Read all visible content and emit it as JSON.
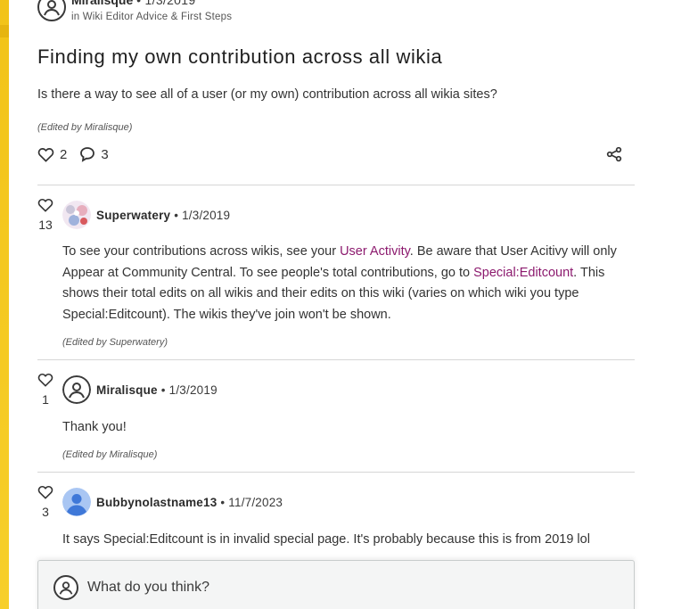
{
  "post": {
    "author": "Miralisque",
    "date": "1/3/2019",
    "forum": "in Wiki Editor Advice & First Steps",
    "title": "Finding my own contribution across all wikia",
    "body": "Is there a way to see all of a user (or my own) contribution across all wikia sites?",
    "edited": "(Edited by Miralisque)",
    "likes": "2",
    "replies": "3"
  },
  "replies": [
    {
      "likes": "13",
      "author": "Superwatery",
      "date": "1/3/2019",
      "body_1": "To see your contributions across wikis, see your ",
      "link_1": "User Activity",
      "body_2": ". Be aware that User Acitivy will only Appear at Community Central. To see people's total contributions, go to ",
      "link_2": "Special:Editcount",
      "body_3": ". This shows their total edits on all wikis and their edits on this wiki (varies on which wiki you type Special:Editcount). The wikis they've join won't be shown.",
      "edited": "(Edited by Superwatery)"
    },
    {
      "likes": "1",
      "author": "Miralisque",
      "date": "1/3/2019",
      "body": "Thank you!",
      "edited": "(Edited by Miralisque)"
    },
    {
      "likes": "3",
      "author": "Bubbynolastname13",
      "date": "11/7/2023",
      "body": "It says Special:Editcount is in invalid special page. It's probably because this is from 2019 lol"
    }
  ],
  "compose": {
    "placeholder": "What do you think?"
  },
  "colors": {
    "accent_rail": "#f2c318",
    "link": "#8c1a6e",
    "divider": "#d6d6d6",
    "compose_bg": "#f4f5f5"
  },
  "icons": {
    "avatar": "user-circle-icon",
    "like": "heart-outline-icon",
    "reply": "speech-bubble-icon",
    "share": "share-nodes-icon"
  }
}
